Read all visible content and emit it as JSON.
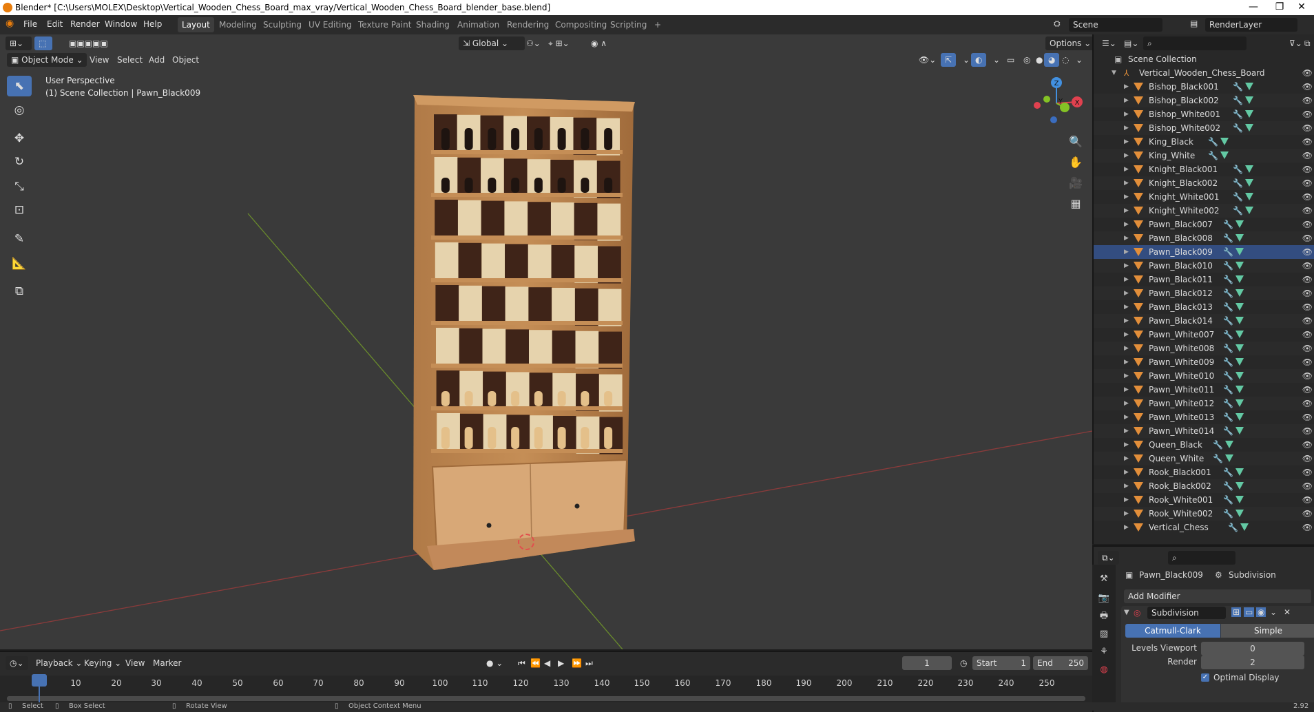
{
  "window": {
    "title": "Blender* [C:\\Users\\MOLEX\\Desktop\\Vertical_Wooden_Chess_Board_max_vray/Vertical_Wooden_Chess_Board_blender_base.blend]",
    "minimize": "—",
    "maximize": "❐",
    "close": "✕"
  },
  "menu": [
    "File",
    "Edit",
    "Render",
    "Window",
    "Help"
  ],
  "workspaces": [
    "Layout",
    "Modeling",
    "Sculpting",
    "UV Editing",
    "Texture Paint",
    "Shading",
    "Animation",
    "Rendering",
    "Compositing",
    "Scripting"
  ],
  "workspace_add": "+",
  "scene": "Scene",
  "render_layer": "RenderLayer",
  "viewport_header": {
    "transform_orientation": "Global",
    "options": "Options",
    "mode": "Object Mode",
    "menus": [
      "View",
      "Select",
      "Add",
      "Object"
    ]
  },
  "viewport_overlay": {
    "perspective": "User Perspective",
    "collection_info": "(1) Scene Collection | Pawn_Black009"
  },
  "gizmo": {
    "z": "Z",
    "x": "X",
    "y": "Y"
  },
  "outliner": {
    "root": "Scene Collection",
    "collection": "Vertical_Wooden_Chess_Board",
    "selected": "Pawn_Black009",
    "items": [
      "Bishop_Black001",
      "Bishop_Black002",
      "Bishop_White001",
      "Bishop_White002",
      "King_Black",
      "King_White",
      "Knight_Black001",
      "Knight_Black002",
      "Knight_White001",
      "Knight_White002",
      "Pawn_Black007",
      "Pawn_Black008",
      "Pawn_Black009",
      "Pawn_Black010",
      "Pawn_Black011",
      "Pawn_Black012",
      "Pawn_Black013",
      "Pawn_Black014",
      "Pawn_White007",
      "Pawn_White008",
      "Pawn_White009",
      "Pawn_White010",
      "Pawn_White011",
      "Pawn_White012",
      "Pawn_White013",
      "Pawn_White014",
      "Queen_Black",
      "Queen_White",
      "Rook_Black001",
      "Rook_Black002",
      "Rook_White001",
      "Rook_White002",
      "Vertical_Chess"
    ]
  },
  "properties": {
    "object": "Pawn_Black009",
    "modifier_tab": "Subdivision",
    "add_modifier": "Add Modifier",
    "modifier_name": "Subdivision",
    "type_catmull": "Catmull-Clark",
    "type_simple": "Simple",
    "levels_viewport_label": "Levels Viewport",
    "levels_viewport": "0",
    "render_label": "Render",
    "render_value": "2",
    "optimal_display": "Optimal Display",
    "optimal_check": "✓"
  },
  "timeline": {
    "menus": [
      "Playback",
      "Keying",
      "View",
      "Marker"
    ],
    "current_frame": "1",
    "start_label": "Start",
    "start": "1",
    "end_label": "End",
    "end": "250",
    "ticks": [
      "1",
      "10",
      "20",
      "30",
      "40",
      "50",
      "60",
      "70",
      "80",
      "90",
      "100",
      "110",
      "120",
      "130",
      "140",
      "150",
      "160",
      "170",
      "180",
      "190",
      "200",
      "210",
      "220",
      "230",
      "240",
      "250"
    ]
  },
  "status": {
    "select": "Select",
    "box_select": "Box Select",
    "rotate": "Rotate View",
    "context": "Object Context Menu",
    "version": "2.92"
  },
  "colors": {
    "accent": "#4772b3",
    "mesh": "#e28e3a",
    "x_axis": "#e0414f",
    "y_axis": "#84c225",
    "z_axis": "#4290e0"
  }
}
